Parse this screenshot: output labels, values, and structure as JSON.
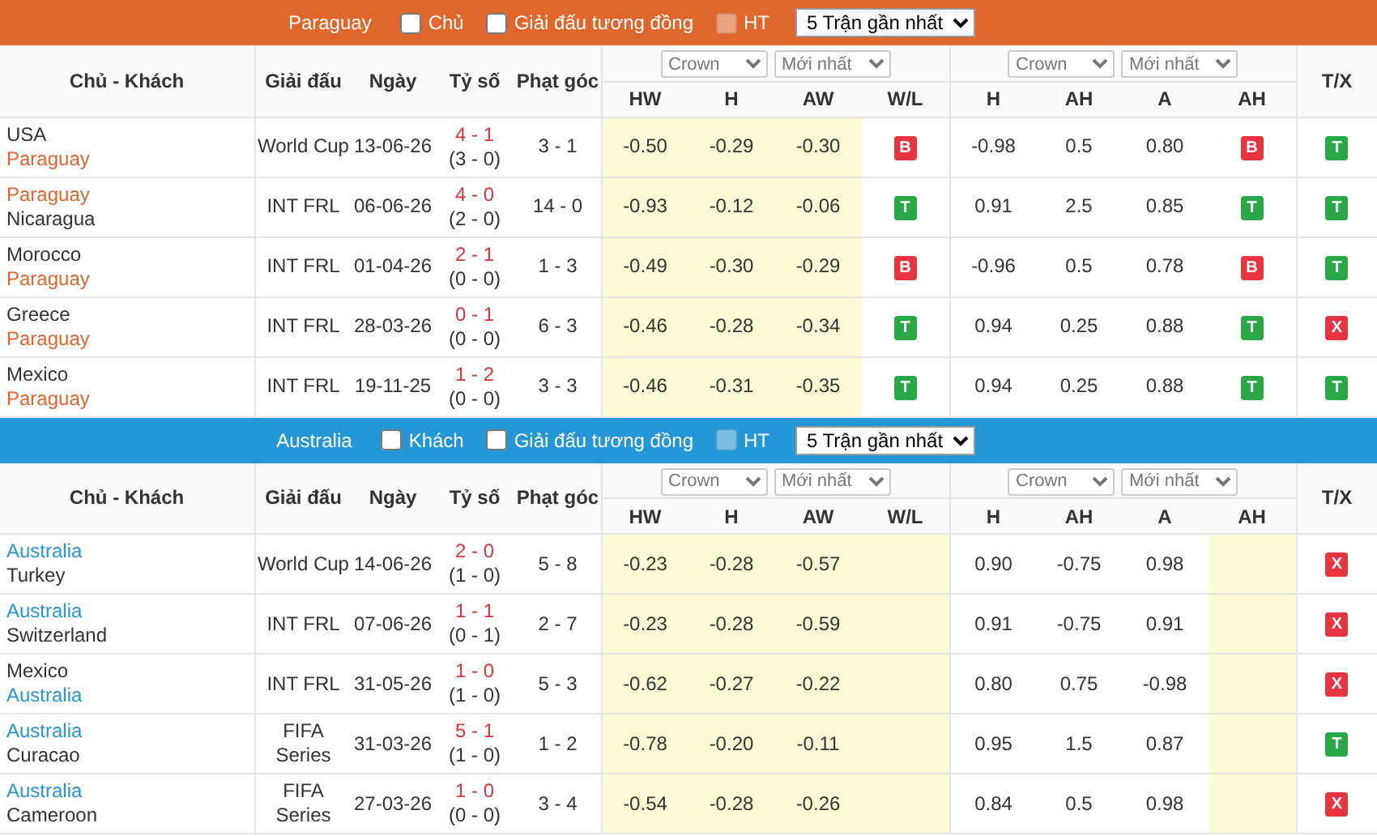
{
  "sections": [
    {
      "team": "Paraguay",
      "color": "#e0662c",
      "filters": [
        {
          "label": "Chủ",
          "checked": false,
          "disabled": false
        },
        {
          "label": "Giải đấu tương đồng",
          "checked": false,
          "disabled": false
        },
        {
          "label": "HT",
          "checked": false,
          "disabled": true
        }
      ],
      "match_count": "5 Trận gần nhất",
      "odds_selects": [
        {
          "provider": "Crown",
          "type": "Mới nhất"
        },
        {
          "provider": "Crown",
          "type": "Mới nhất"
        }
      ],
      "columns": [
        {
          "label": "Chủ - Khách",
          "highlighted": false
        },
        {
          "label": "Giải đấu",
          "highlighted": false
        },
        {
          "label": "Ngày",
          "highlighted": false
        },
        {
          "label": "Tỷ số",
          "highlighted": false
        },
        {
          "label": "Phạt góc",
          "highlighted": false
        },
        {
          "label": "HW",
          "highlighted": true
        },
        {
          "label": "H",
          "highlighted": true
        },
        {
          "label": "AW",
          "highlighted": true
        },
        {
          "label": "W/L",
          "highlighted": false
        },
        {
          "label": "H",
          "highlighted": false
        },
        {
          "label": "AH",
          "highlighted": false
        },
        {
          "label": "A",
          "highlighted": false
        },
        {
          "label": "AH",
          "highlighted": false
        },
        {
          "label": "T/X",
          "highlighted": false
        }
      ],
      "rows": [
        {
          "home": {
            "name": "USA",
            "highlighted": false
          },
          "away": {
            "name": "Paraguay",
            "highlighted": true
          },
          "league": "World Cup",
          "date": "13-06-26",
          "score": "4 - 1",
          "half_time": "(3 - 0)",
          "corners": "3 - 1",
          "odds": [
            "-0.50",
            "-0.29",
            "-0.30"
          ],
          "wl": {
            "text": "B",
            "kind": "loss"
          },
          "handicap": [
            "-0.98",
            "0.5",
            "0.80"
          ],
          "ah": {
            "text": "B",
            "kind": "loss"
          },
          "tx": {
            "text": "T",
            "kind": "win"
          }
        },
        {
          "home": {
            "name": "Paraguay",
            "highlighted": true
          },
          "away": {
            "name": "Nicaragua",
            "highlighted": false
          },
          "league": "INT FRL",
          "date": "06-06-26",
          "score": "4 - 0",
          "half_time": "(2 - 0)",
          "corners": "14 - 0",
          "odds": [
            "-0.93",
            "-0.12",
            "-0.06"
          ],
          "wl": {
            "text": "T",
            "kind": "win"
          },
          "handicap": [
            "0.91",
            "2.5",
            "0.85"
          ],
          "ah": {
            "text": "T",
            "kind": "win"
          },
          "tx": {
            "text": "T",
            "kind": "win"
          }
        },
        {
          "home": {
            "name": "Morocco",
            "highlighted": false
          },
          "away": {
            "name": "Paraguay",
            "highlighted": true
          },
          "league": "INT FRL",
          "date": "01-04-26",
          "score": "2 - 1",
          "half_time": "(0 - 0)",
          "corners": "1 - 3",
          "odds": [
            "-0.49",
            "-0.30",
            "-0.29"
          ],
          "wl": {
            "text": "B",
            "kind": "loss"
          },
          "handicap": [
            "-0.96",
            "0.5",
            "0.78"
          ],
          "ah": {
            "text": "B",
            "kind": "loss"
          },
          "tx": {
            "text": "T",
            "kind": "win"
          }
        },
        {
          "home": {
            "name": "Greece",
            "highlighted": false
          },
          "away": {
            "name": "Paraguay",
            "highlighted": true
          },
          "league": "INT FRL",
          "date": "28-03-26",
          "score": "0 - 1",
          "half_time": "(0 - 0)",
          "corners": "6 - 3",
          "odds": [
            "-0.46",
            "-0.28",
            "-0.34"
          ],
          "wl": {
            "text": "T",
            "kind": "win"
          },
          "handicap": [
            "0.94",
            "0.25",
            "0.88"
          ],
          "ah": {
            "text": "T",
            "kind": "win"
          },
          "tx": {
            "text": "X",
            "kind": "loss"
          }
        },
        {
          "home": {
            "name": "Mexico",
            "highlighted": false
          },
          "away": {
            "name": "Paraguay",
            "highlighted": true
          },
          "league": "INT FRL",
          "date": "19-11-25",
          "score": "1 - 2",
          "half_time": "(0 - 0)",
          "corners": "3 - 3",
          "odds": [
            "-0.46",
            "-0.31",
            "-0.35"
          ],
          "wl": {
            "text": "T",
            "kind": "win"
          },
          "handicap": [
            "0.94",
            "0.25",
            "0.88"
          ],
          "ah": {
            "text": "T",
            "kind": "win"
          },
          "tx": {
            "text": "T",
            "kind": "win"
          }
        }
      ]
    },
    {
      "team": "Australia",
      "color": "#2596d8",
      "filters": [
        {
          "label": "Khách",
          "checked": false,
          "disabled": false
        },
        {
          "label": "Giải đấu tương đồng",
          "checked": false,
          "disabled": false
        },
        {
          "label": "HT",
          "checked": false,
          "disabled": true
        }
      ],
      "match_count": "5 Trận gần nhất",
      "odds_selects": [
        {
          "provider": "Crown",
          "type": "Mới nhất"
        },
        {
          "provider": "Crown",
          "type": "Mới nhất"
        }
      ],
      "columns": [
        {
          "label": "Chủ - Khách",
          "highlighted": false
        },
        {
          "label": "Giải đấu",
          "highlighted": false
        },
        {
          "label": "Ngày",
          "highlighted": false
        },
        {
          "label": "Tỷ số",
          "highlighted": false
        },
        {
          "label": "Phạt góc",
          "highlighted": false
        },
        {
          "label": "HW",
          "highlighted": true
        },
        {
          "label": "H",
          "highlighted": true
        },
        {
          "label": "AW",
          "highlighted": true
        },
        {
          "label": "W/L",
          "highlighted": true
        },
        {
          "label": "H",
          "highlighted": false
        },
        {
          "label": "AH",
          "highlighted": false
        },
        {
          "label": "A",
          "highlighted": false
        },
        {
          "label": "AH",
          "highlighted": true
        },
        {
          "label": "T/X",
          "highlighted": false
        }
      ],
      "rows": [
        {
          "home": {
            "name": "Australia",
            "highlighted": true
          },
          "away": {
            "name": "Turkey",
            "highlighted": false
          },
          "league": "World Cup",
          "date": "14-06-26",
          "score": "2 - 0",
          "half_time": "(1 - 0)",
          "corners": "5 - 8",
          "odds": [
            "-0.23",
            "-0.28",
            "-0.57"
          ],
          "handicap": [
            "0.90",
            "-0.75",
            "0.98"
          ],
          "tx": {
            "text": "X",
            "kind": "loss"
          }
        },
        {
          "home": {
            "name": "Australia",
            "highlighted": true
          },
          "away": {
            "name": "Switzerland",
            "highlighted": false
          },
          "league": "INT FRL",
          "date": "07-06-26",
          "score": "1 - 1",
          "half_time": "(0 - 1)",
          "corners": "2 - 7",
          "odds": [
            "-0.23",
            "-0.28",
            "-0.59"
          ],
          "handicap": [
            "0.91",
            "-0.75",
            "0.91"
          ],
          "tx": {
            "text": "X",
            "kind": "loss"
          }
        },
        {
          "home": {
            "name": "Mexico",
            "highlighted": false
          },
          "away": {
            "name": "Australia",
            "highlighted": true
          },
          "league": "INT FRL",
          "date": "31-05-26",
          "score": "1 - 0",
          "half_time": "(1 - 0)",
          "corners": "5 - 3",
          "odds": [
            "-0.62",
            "-0.27",
            "-0.22"
          ],
          "handicap": [
            "0.80",
            "0.75",
            "-0.98"
          ],
          "tx": {
            "text": "X",
            "kind": "loss"
          }
        },
        {
          "home": {
            "name": "Australia",
            "highlighted": true
          },
          "away": {
            "name": "Curacao",
            "highlighted": false
          },
          "league": "FIFA Series",
          "date": "31-03-26",
          "score": "5 - 1",
          "half_time": "(1 - 0)",
          "corners": "1 - 2",
          "odds": [
            "-0.78",
            "-0.20",
            "-0.11"
          ],
          "handicap": [
            "0.95",
            "1.5",
            "0.87"
          ],
          "tx": {
            "text": "T",
            "kind": "win"
          }
        },
        {
          "home": {
            "name": "Australia",
            "highlighted": true
          },
          "away": {
            "name": "Cameroon",
            "highlighted": false
          },
          "league": "FIFA Series",
          "date": "27-03-26",
          "score": "1 - 0",
          "half_time": "(0 - 0)",
          "corners": "3 - 4",
          "odds": [
            "-0.54",
            "-0.28",
            "-0.26"
          ],
          "handicap": [
            "0.84",
            "0.5",
            "0.98"
          ],
          "tx": {
            "text": "X",
            "kind": "loss"
          }
        }
      ]
    }
  ]
}
